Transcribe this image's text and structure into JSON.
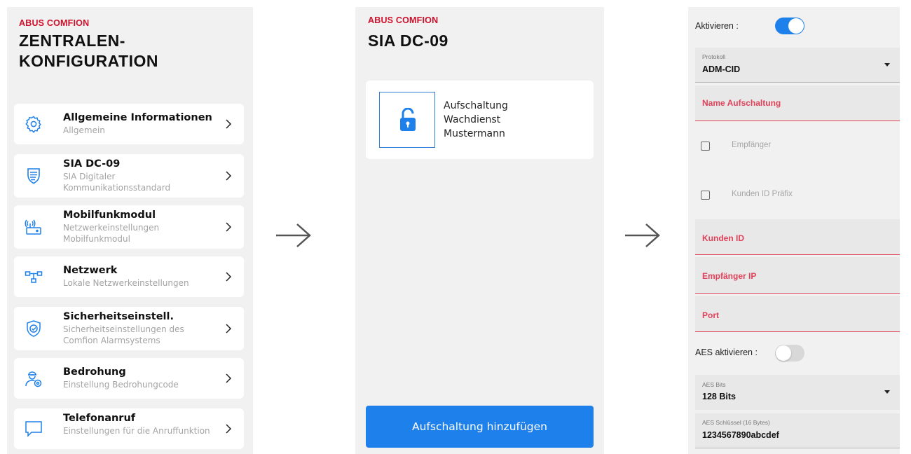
{
  "screen1": {
    "brand": "ABUS COMFION",
    "title_line1": "ZENTRALEN-",
    "title_line2": "KONFIGURATION",
    "items": [
      {
        "title": "Allgemeine Informationen",
        "subtitle": "Allgemein",
        "icon": "gear-icon"
      },
      {
        "title": "SIA DC-09",
        "subtitle": "SIA Digitaler Kommunikationsstandard",
        "icon": "shield-icon"
      },
      {
        "title": "Mobilfunkmodul",
        "subtitle": "Netzwerkeinstellungen Mobilfunkmodul",
        "icon": "router-icon"
      },
      {
        "title": "Netzwerk",
        "subtitle": "Lokale Netzwerkeinstellungen",
        "icon": "network-icon"
      },
      {
        "title": "Sicherheitseinstell.",
        "subtitle": "Sicherheitseinstellungen des Comfion Alarmsystems",
        "icon": "security-shield-icon"
      },
      {
        "title": "Bedrohung",
        "subtitle": "Einstellung Bedrohungcode",
        "icon": "user-threat-icon"
      },
      {
        "title": "Telefonanruf",
        "subtitle": "Einstellungen für die Anruffunktion",
        "icon": "speech-bubble-icon"
      }
    ]
  },
  "screen2": {
    "brand": "ABUS COMFION",
    "title": "SIA DC-09",
    "entry_line1": "Aufschaltung",
    "entry_line2": "Wachdienst",
    "entry_line3": "Mustermann",
    "add_button": "Aufschaltung hinzufügen"
  },
  "screen3": {
    "activate_label": "Aktivieren :",
    "activate_on": true,
    "protokoll_label": "Protokoll",
    "protokoll_value": "ADM-CID",
    "name_label": "Name Aufschaltung",
    "empfaenger_label": "Empfänger",
    "kunden_prefix_label": "Kunden ID Präfix",
    "kunden_id_label": "Kunden ID",
    "empfaenger_ip_label": "Empfänger IP",
    "port_label": "Port",
    "aes_label": "AES aktivieren :",
    "aes_on": false,
    "aes_bits_label": "AES Bits",
    "aes_bits_value": "128 Bits",
    "aes_key_label": "AES Schlüssel (16 Bytes)",
    "aes_key_value": "1234567890abcdef"
  },
  "colors": {
    "brand_red": "#d0102b",
    "accent_blue": "#1e80ea",
    "field_red": "#e0425a"
  }
}
